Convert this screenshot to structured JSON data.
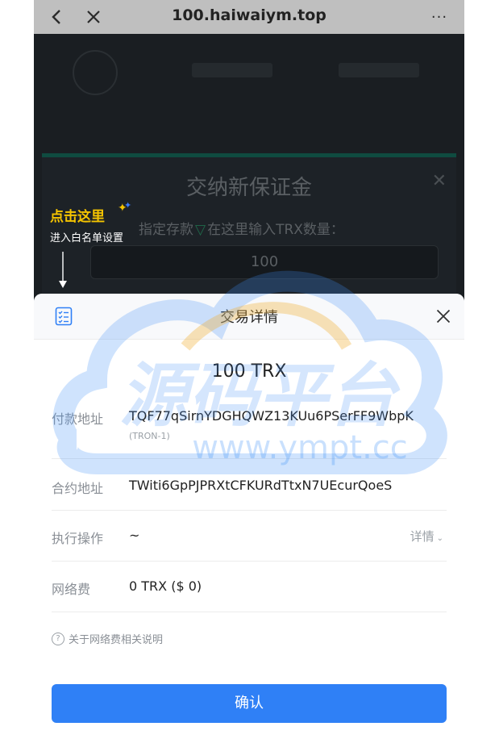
{
  "browser": {
    "url": "100.haiwaiym.top",
    "back_icon": "chevron-left-icon",
    "close_icon": "close-icon",
    "more_label": "···"
  },
  "background_dialog": {
    "title": "交纳新保证金",
    "label_prefix": "指定存款",
    "label_suffix": "在这里输入TRX数量：",
    "input_value": "100"
  },
  "hint": {
    "title": "点击这里",
    "subtitle": "进入白名单设置"
  },
  "sheet": {
    "title": "交易详情",
    "amount": "100 TRX",
    "rows": [
      {
        "label": "付款地址",
        "value": "TQF77qSirnYDGHQWZ13KUu6PSerFF9WbpK",
        "sub": "(TRON-1)"
      },
      {
        "label": "合约地址",
        "value": "TWiti6GpPJPRXtCFKURdTtxN7UEcurQoeS"
      },
      {
        "label": "执行操作",
        "value": "~",
        "detail": "详情"
      },
      {
        "label": "网络费",
        "value": "0 TRX ($ 0)"
      }
    ],
    "fee_note": "关于网络费相关说明",
    "confirm_label": "确认"
  },
  "watermark": {
    "text": "源码平台",
    "url": "www.ympt.cc"
  },
  "colors": {
    "primary": "#2f80f6",
    "hint_yellow": "#f5c400",
    "overlay": "#1a1e22"
  }
}
